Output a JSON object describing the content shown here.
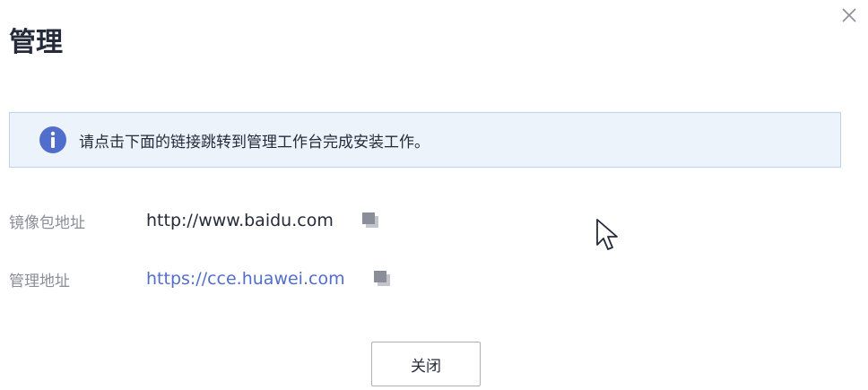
{
  "dialog": {
    "title": "管理",
    "close_icon": "close-icon"
  },
  "banner": {
    "icon": "info-icon",
    "icon_color": "#526ecc",
    "text": "请点击下面的链接跳转到管理工作台完成安装工作。"
  },
  "fields": [
    {
      "label": "镜像包地址",
      "value": "http://www.baidu.com",
      "is_link": false,
      "copy_icon": "copy-icon"
    },
    {
      "label": "管理地址",
      "value": "https://cce.huawei.com",
      "is_link": true,
      "copy_icon": "copy-icon"
    }
  ],
  "footer": {
    "close_button_label": "关闭"
  },
  "colors": {
    "link": "#526ecc",
    "banner_bg": "#edf3fb",
    "banner_border": "#bfd3ec",
    "label": "#8a8e99",
    "text": "#252b3a"
  }
}
